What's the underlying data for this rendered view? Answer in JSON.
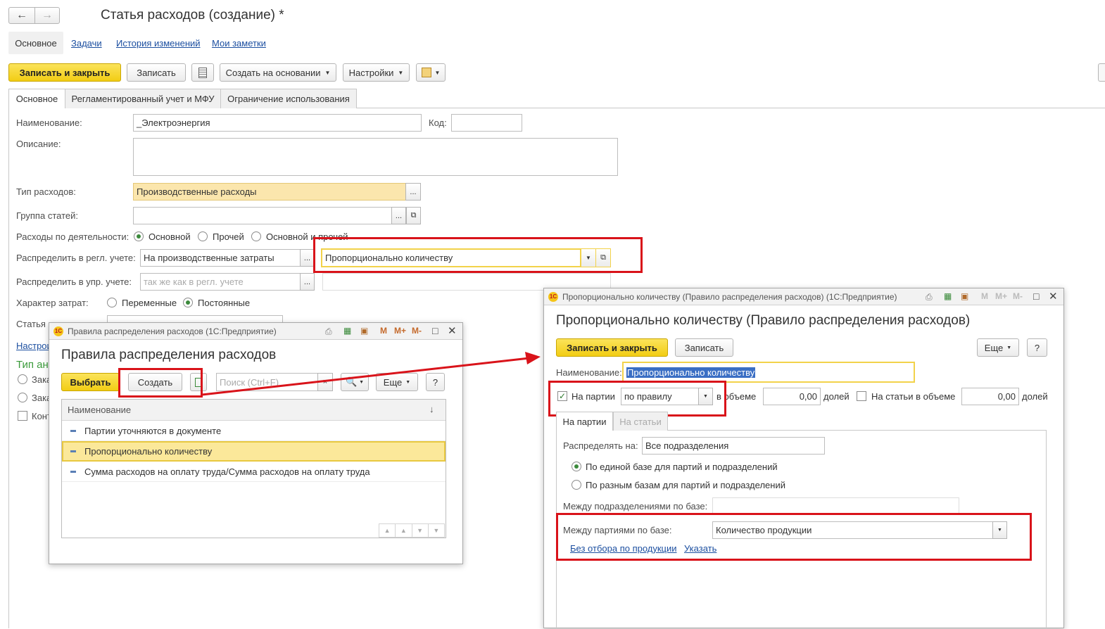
{
  "main_window": {
    "title": "Статья расходов (создание) *",
    "nav_back": "🡐",
    "nav_forward": "🡒",
    "nav_tabs": [
      "Основное",
      "Задачи",
      "История изменений",
      "Мои заметки"
    ],
    "toolbar": {
      "save_close": "Записать и закрыть",
      "save": "Записать",
      "create_based": "Создать на основании",
      "settings": "Настройки"
    },
    "tabs": [
      "Основное",
      "Регламентированный учет и МФУ",
      "Ограничение использования"
    ],
    "fields": {
      "name_label": "Наименование:",
      "name_value": "_Электроэнергия",
      "code_label": "Код:",
      "code_value": "",
      "description_label": "Описание:",
      "expense_type_label": "Тип расходов:",
      "expense_type_value": "Производственные расходы",
      "group_label": "Группа статей:",
      "group_value": "",
      "activity_label": "Расходы по деятельности:",
      "activity_options": [
        "Основной",
        "Прочей",
        "Основной и прочей"
      ],
      "activity_selected": 0,
      "distribute_reg_label": "Распределить в регл. учете:",
      "distribute_reg_value": "На производственные затраты",
      "distribute_reg_rule": "Пропорционально количеству",
      "distribute_mgmt_label": "Распределить в упр. учете:",
      "distribute_mgmt_placeholder": "так же как в регл. учете",
      "cost_nature_label": "Характер затрат:",
      "cost_nature_options": [
        "Переменные",
        "Постоянные"
      ],
      "cost_nature_selected": 1,
      "article_label": "Статья к",
      "settings_link": "Настрои",
      "analytics_header": "Тип ана",
      "analytics_options": [
        "Зака",
        "Зака"
      ],
      "control_label": "Конт"
    }
  },
  "rules_window": {
    "titlebar": "Правила распределения расходов (1С:Предприятие)",
    "title": "Правила распределения расходов",
    "select_btn": "Выбрать",
    "create_btn": "Создать",
    "search_placeholder": "Поиск (Ctrl+F)",
    "more_btn": "Еще",
    "help_btn": "?",
    "column_header": "Наименование",
    "rows": [
      "Партии уточняются в документе",
      "Пропорционально количеству",
      "Сумма расходов на оплату труда/Сумма расходов на оплату труда"
    ],
    "selected_row": 1
  },
  "rule_window": {
    "titlebar": "Пропорционально количеству (Правило распределения расходов) (1С:Предприятие)",
    "title": "Пропорционально количеству (Правило распределения расходов)",
    "save_close": "Записать и закрыть",
    "save": "Записать",
    "more_btn": "Еще",
    "help_btn": "?",
    "name_label": "Наименование:",
    "name_value": "Пропорционально количеству",
    "on_batches_label": "На партии",
    "on_batches_checked": true,
    "on_batches_mode": "по правилу",
    "volume_label": "в объеме",
    "volume_value": "0,00",
    "shares_label": "долей",
    "on_articles_label": "На статьи в объеме",
    "on_articles_checked": false,
    "articles_value": "0,00",
    "articles_shares_label": "долей",
    "tabs": [
      "На партии",
      "На статьи"
    ],
    "distribute_to_label": "Распределять на:",
    "distribute_to_value": "Все подразделения",
    "base_options": [
      "По единой базе для партий и подразделений",
      "По разным базам для партий и подразделений"
    ],
    "base_selected": 0,
    "between_depts_label": "Между подразделениями по базе:",
    "between_depts_value": "",
    "between_batches_label": "Между партиями по базе:",
    "between_batches_value": "Количество продукции",
    "filter_link": "Без отбора по продукции",
    "specify_link": "Указать"
  },
  "colors": {
    "accent_yellow": "#f2cd14",
    "highlight_red": "#d9131a",
    "selected_row": "#fbe89a",
    "link_blue": "#1c4fa0"
  }
}
